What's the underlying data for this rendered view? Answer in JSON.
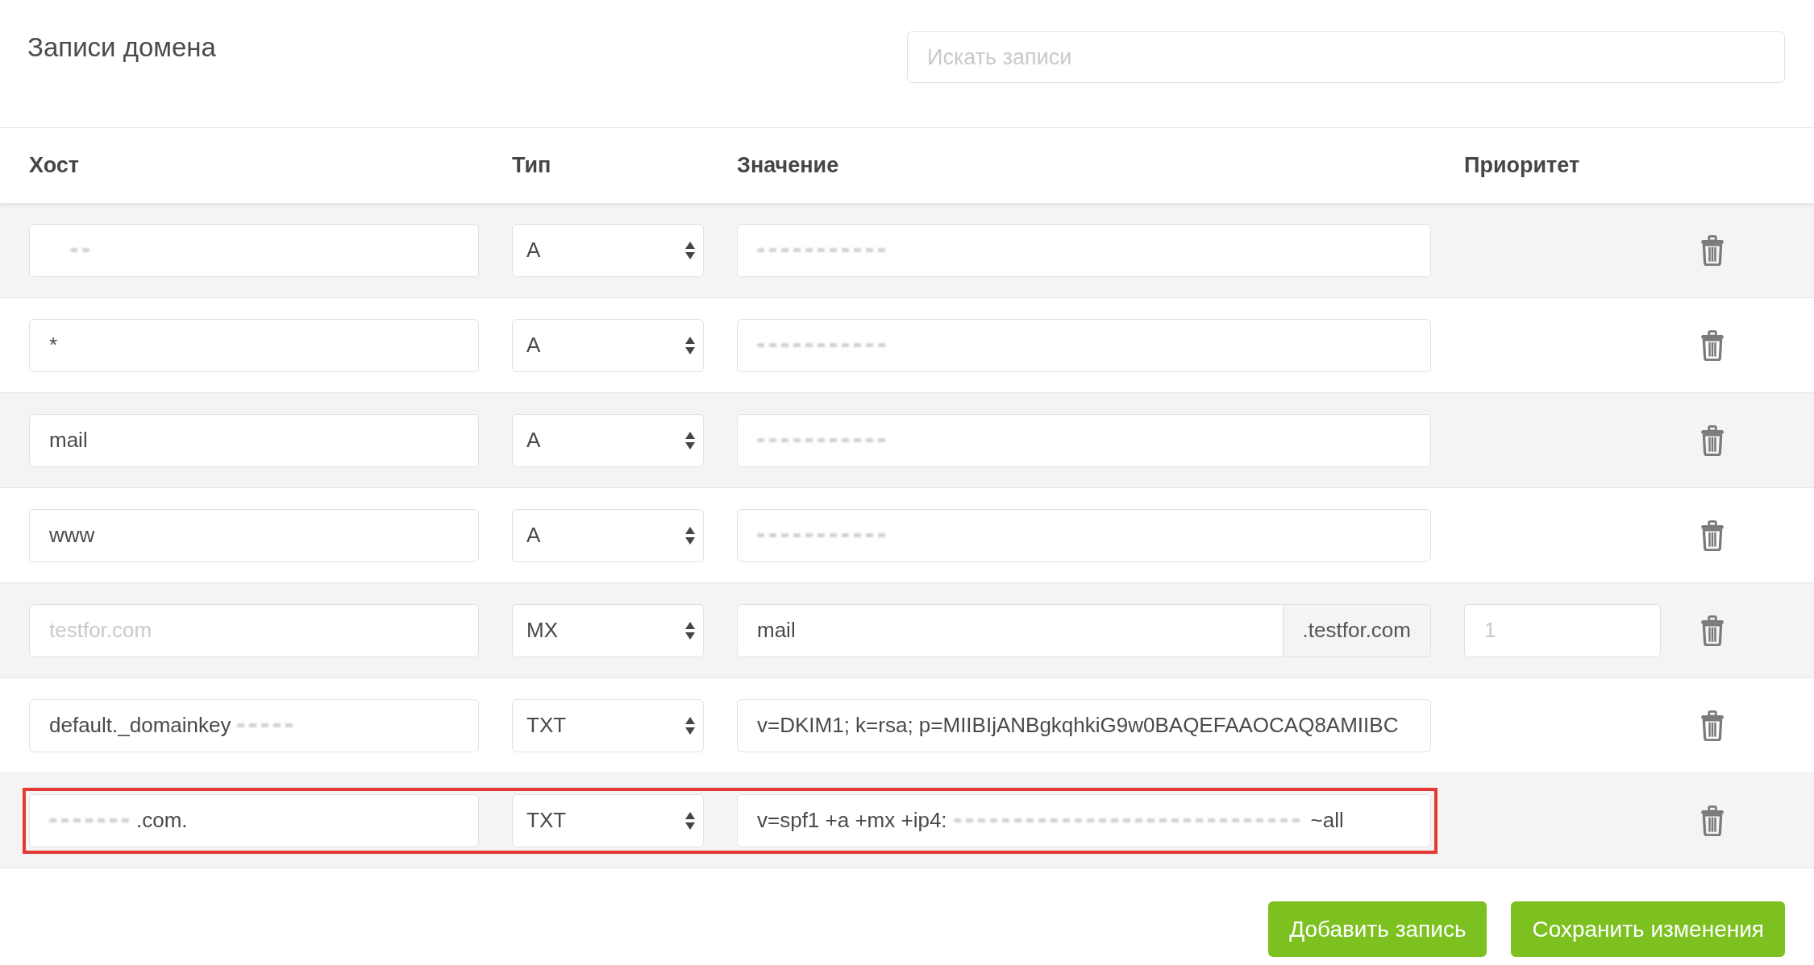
{
  "page": {
    "title": "Записи домена",
    "search": {
      "placeholder": "Искать записи"
    }
  },
  "table": {
    "columns": [
      "Хост",
      "Тип",
      "Значение",
      "Приоритет"
    ],
    "rows": [
      {
        "host": {
          "parts": [
            {
              "kind": "redacted"
            }
          ]
        },
        "type": "A",
        "value": {
          "parts": [
            {
              "kind": "redacted"
            }
          ]
        },
        "highlighted": false
      },
      {
        "host": {
          "parts": [
            {
              "kind": "text",
              "text": "*"
            }
          ]
        },
        "type": "A",
        "value": {
          "parts": [
            {
              "kind": "redacted"
            }
          ]
        },
        "highlighted": false
      },
      {
        "host": {
          "parts": [
            {
              "kind": "text",
              "text": "mail"
            }
          ]
        },
        "type": "A",
        "value": {
          "parts": [
            {
              "kind": "redacted"
            }
          ]
        },
        "highlighted": false
      },
      {
        "host": {
          "parts": [
            {
              "kind": "text",
              "text": "www"
            }
          ]
        },
        "type": "A",
        "value": {
          "parts": [
            {
              "kind": "redacted"
            }
          ]
        },
        "highlighted": false
      },
      {
        "host": {
          "placeholder": "testfor.com"
        },
        "type": "MX",
        "value": {
          "parts": [
            {
              "kind": "text",
              "text": "mail"
            }
          ],
          "suffix": ".testfor.com"
        },
        "priority": {
          "placeholder": "1"
        },
        "highlighted": false
      },
      {
        "host": {
          "parts": [
            {
              "kind": "text",
              "text": "default._domainkey"
            },
            {
              "kind": "redacted"
            }
          ]
        },
        "type": "TXT",
        "value": {
          "parts": [
            {
              "kind": "text",
              "text": "v=DKIM1; k=rsa; p=MIIBIjANBgkqhkiG9w0BAQEFAAOCAQ8AMIIBC"
            }
          ]
        },
        "highlighted": false
      },
      {
        "host": {
          "parts": [
            {
              "kind": "redacted"
            },
            {
              "kind": "text",
              "text": ".com."
            }
          ]
        },
        "type": "TXT",
        "value": {
          "parts": [
            {
              "kind": "text",
              "text": "v=spf1 +a +mx +ip4:"
            },
            {
              "kind": "redacted"
            },
            {
              "kind": "text",
              "text": "~all"
            }
          ]
        },
        "highlighted": true
      }
    ]
  },
  "buttons": [
    "Добавить запись",
    "Сохранить изменения"
  ]
}
